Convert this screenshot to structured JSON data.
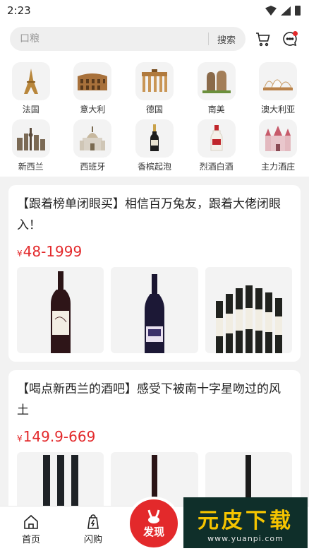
{
  "status": {
    "time": "2:23"
  },
  "header": {
    "search_placeholder": "口粮",
    "search_button": "搜索"
  },
  "categories": [
    {
      "label": "法国",
      "icon": "eiffel-tower-icon"
    },
    {
      "label": "意大利",
      "icon": "colosseum-icon"
    },
    {
      "label": "德国",
      "icon": "brandenburg-gate-icon"
    },
    {
      "label": "南美",
      "icon": "moai-icon"
    },
    {
      "label": "澳大利亚",
      "icon": "opera-house-icon"
    },
    {
      "label": "新西兰",
      "icon": "city-skyline-icon"
    },
    {
      "label": "西班牙",
      "icon": "cathedral-icon"
    },
    {
      "label": "香槟起泡",
      "icon": "champagne-bottle-icon"
    },
    {
      "label": "烈酒白酒",
      "icon": "baijiu-bottle-icon"
    },
    {
      "label": "主力酒庄",
      "icon": "castle-icon"
    }
  ],
  "cards": [
    {
      "title": "【跟着榜单闭眼买】相信百万兔友，跟着大佬闭眼入！",
      "currency": "¥",
      "price": "48-1999"
    },
    {
      "title": "【喝点新西兰的酒吧】感受下被南十字星吻过的风土",
      "currency": "¥",
      "price": "149.9-669"
    }
  ],
  "tabbar": {
    "home": "首页",
    "flash": "闪购",
    "discover": "发现"
  },
  "watermark": {
    "big": "元皮下载",
    "small": "www.yuanpi.com"
  },
  "colors": {
    "accent": "#e3292b"
  }
}
